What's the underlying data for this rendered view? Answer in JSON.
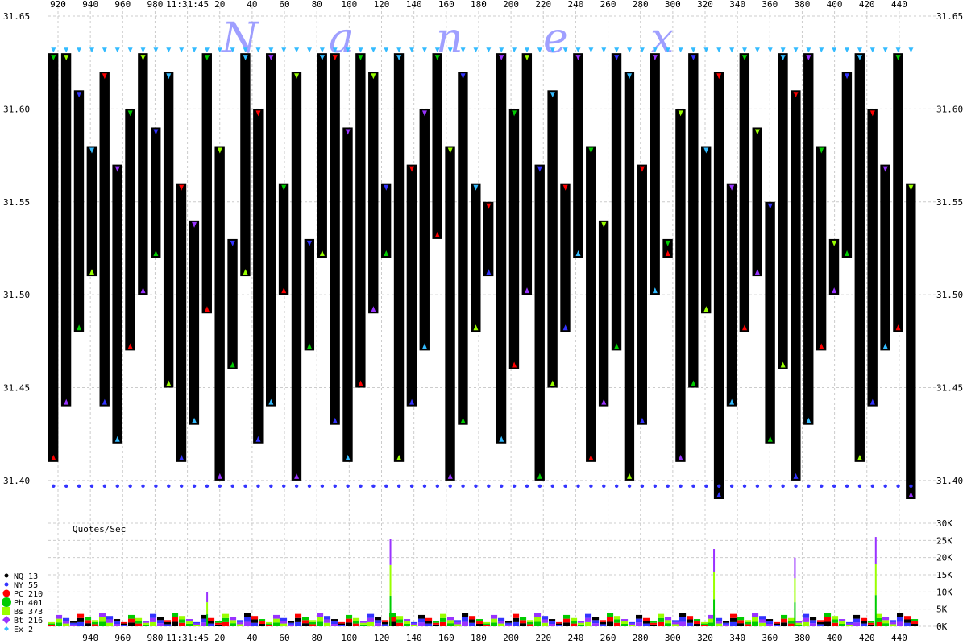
{
  "chart_data": [
    {
      "type": "area",
      "name": "price-panel",
      "title": "",
      "watermark": [
        "N",
        "a",
        "n",
        "e",
        "x"
      ],
      "x_ticks_top": [
        "920",
        "940",
        "960",
        "980",
        "11:31:45",
        "20",
        "40",
        "60",
        "80",
        "100",
        "120",
        "140",
        "160",
        "180",
        "200",
        "220",
        "240",
        "260",
        "280",
        "300",
        "320",
        "340",
        "360",
        "380",
        "400",
        "420",
        "440"
      ],
      "x_ticks_bottom": [
        "940",
        "960",
        "980",
        "11:31:45",
        "20",
        "40",
        "60",
        "80",
        "100",
        "120",
        "140",
        "160",
        "180",
        "200",
        "220",
        "240",
        "260",
        "280",
        "300",
        "320",
        "340",
        "360",
        "380",
        "400",
        "420",
        "440"
      ],
      "y_ticks": [
        "31.65",
        "31.60",
        "31.55",
        "31.50",
        "31.45",
        "31.40"
      ],
      "ylim": [
        31.39,
        31.65
      ],
      "xlim": [
        912,
        457
      ],
      "grid": true,
      "series": [
        {
          "name": "best_ask",
          "values": [
            31.63,
            31.63,
            31.61,
            31.58,
            31.62,
            31.57,
            31.6,
            31.63,
            31.59,
            31.62,
            31.56,
            31.54,
            31.63,
            31.58,
            31.53,
            31.63,
            31.6,
            31.63,
            31.56,
            31.62,
            31.53,
            31.63,
            31.63,
            31.59,
            31.63,
            31.62,
            31.56,
            31.63,
            31.57,
            31.6,
            31.63,
            31.58,
            31.62,
            31.56,
            31.55,
            31.63,
            31.6,
            31.63,
            31.57,
            31.61,
            31.56,
            31.63,
            31.58,
            31.54,
            31.63,
            31.62,
            31.57,
            31.63,
            31.53,
            31.6,
            31.63,
            31.58,
            31.62,
            31.56,
            31.63,
            31.59,
            31.55,
            31.63,
            31.61,
            31.63,
            31.58,
            31.53,
            31.62,
            31.63,
            31.6,
            31.57,
            31.63,
            31.56
          ]
        },
        {
          "name": "best_bid",
          "values": [
            31.41,
            31.44,
            31.48,
            31.51,
            31.44,
            31.42,
            31.47,
            31.5,
            31.52,
            31.45,
            31.41,
            31.43,
            31.49,
            31.4,
            31.46,
            31.51,
            31.42,
            31.44,
            31.5,
            31.4,
            31.47,
            31.52,
            31.43,
            31.41,
            31.45,
            31.49,
            31.52,
            31.41,
            31.44,
            31.47,
            31.53,
            31.4,
            31.43,
            31.48,
            31.51,
            31.42,
            31.46,
            31.5,
            31.4,
            31.45,
            31.48,
            31.52,
            31.41,
            31.44,
            31.47,
            31.4,
            31.43,
            31.5,
            31.52,
            31.41,
            31.45,
            31.49,
            31.39,
            31.44,
            31.48,
            31.51,
            31.42,
            31.46,
            31.4,
            31.43,
            31.47,
            31.5,
            31.52,
            31.41,
            31.44,
            31.47,
            31.48,
            31.39
          ]
        }
      ],
      "exchange_colors": {
        "NQ": "#000000",
        "NY": "#3333ff",
        "PC": "#ff0000",
        "Ph": "#00cc00",
        "Bs": "#99ff00",
        "Bt": "#9933ff",
        "Ex": "#33bbff"
      }
    },
    {
      "type": "bar",
      "name": "quote-rate-panel",
      "title": "Quotes/Sec",
      "y_ticks": [
        "30K",
        "25K",
        "20K",
        "15K",
        "10K",
        "5K",
        "0K"
      ],
      "ylim": [
        0,
        30000
      ],
      "categories_count": 120,
      "spikes": [
        {
          "x": 11.7,
          "value": 10000
        },
        {
          "x": 125,
          "value": 25500
        },
        {
          "x": 325,
          "value": 22500
        },
        {
          "x": 375,
          "value": 20000
        },
        {
          "x": 425,
          "value": 26000
        }
      ],
      "base_level": 3000
    }
  ],
  "legend": [
    {
      "code": "NQ",
      "count": "13",
      "color": "#000000",
      "shape": "dot-small"
    },
    {
      "code": "NY",
      "count": "55",
      "color": "#3333ff",
      "shape": "dot-small"
    },
    {
      "code": "PC",
      "count": "210",
      "color": "#ff0000",
      "shape": "dot"
    },
    {
      "code": "Ph",
      "count": "401",
      "color": "#00cc00",
      "shape": "dot-large"
    },
    {
      "code": "Bs",
      "count": "373",
      "color": "#99ff00",
      "shape": "square"
    },
    {
      "code": "Bt",
      "count": "216",
      "color": "#9933ff",
      "shape": "diamond"
    },
    {
      "code": "Ex",
      "count": "2",
      "color": "#33bbff",
      "shape": "diamond-small"
    }
  ]
}
